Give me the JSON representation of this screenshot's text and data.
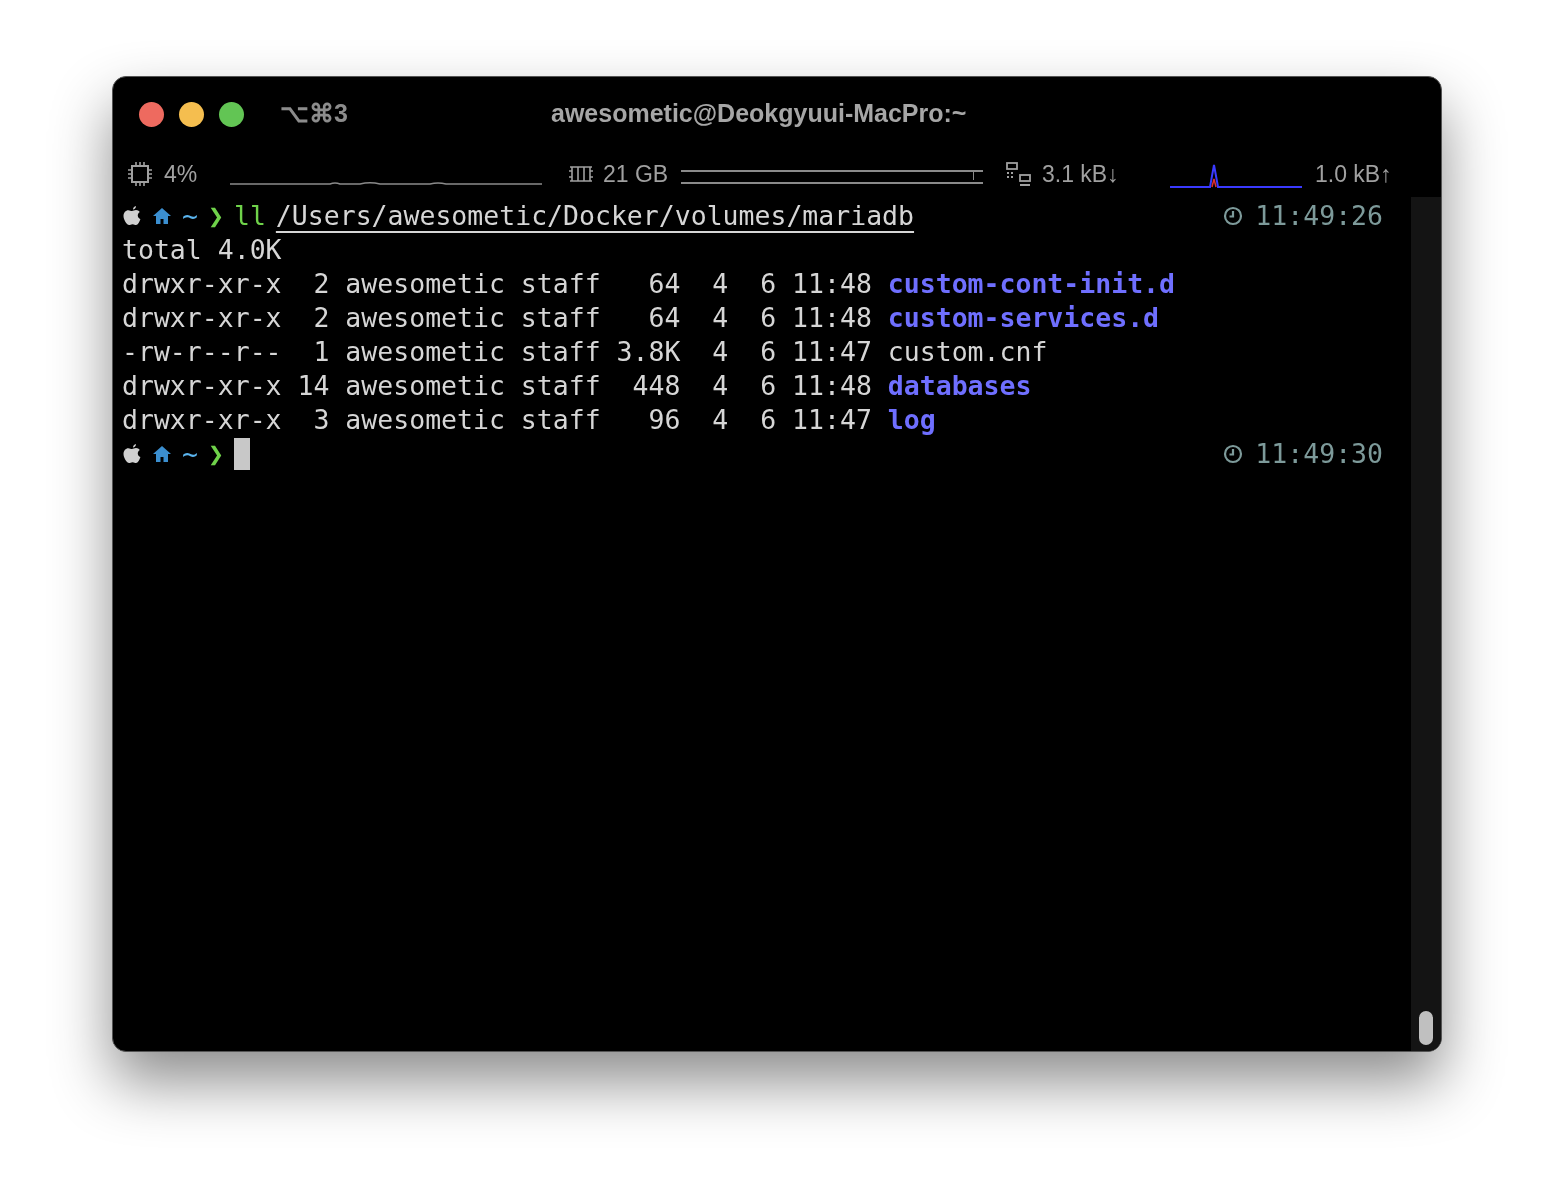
{
  "window": {
    "title": "awesometic@Deokgyuui-MacPro:~",
    "shortcut": "⌥⌘3"
  },
  "status_bar": {
    "cpu": "4%",
    "memory": "21 GB",
    "memory_meter": {
      "level": 0.97
    },
    "download": "3.1 kB↓",
    "upload": "1.0 kB↑"
  },
  "prompts": [
    {
      "tilde": "~",
      "arrow": "❯",
      "command": "ll",
      "argument": "/Users/awesometic/Docker/volumes/mariadb",
      "time": "11:49:26",
      "cursor": false
    },
    {
      "tilde": "~",
      "arrow": "❯",
      "time": "11:49:30",
      "cursor": true
    }
  ],
  "output": {
    "total": "total 4.0K",
    "rows": [
      {
        "info": "drwxr-xr-x  2 awesometic staff   64  4  6 11:48",
        "name": "custom-cont-init.d",
        "kind": "dir"
      },
      {
        "info": "drwxr-xr-x  2 awesometic staff   64  4  6 11:48",
        "name": "custom-services.d",
        "kind": "dir"
      },
      {
        "info": "-rw-r--r--  1 awesometic staff 3.8K  4  6 11:47",
        "name": "custom.cnf",
        "kind": "file"
      },
      {
        "info": "drwxr-xr-x 14 awesometic staff  448  4  6 11:48",
        "name": "databases",
        "kind": "dir"
      },
      {
        "info": "drwxr-xr-x  3 awesometic staff   96  4  6 11:47",
        "name": "log",
        "kind": "dir"
      }
    ]
  }
}
